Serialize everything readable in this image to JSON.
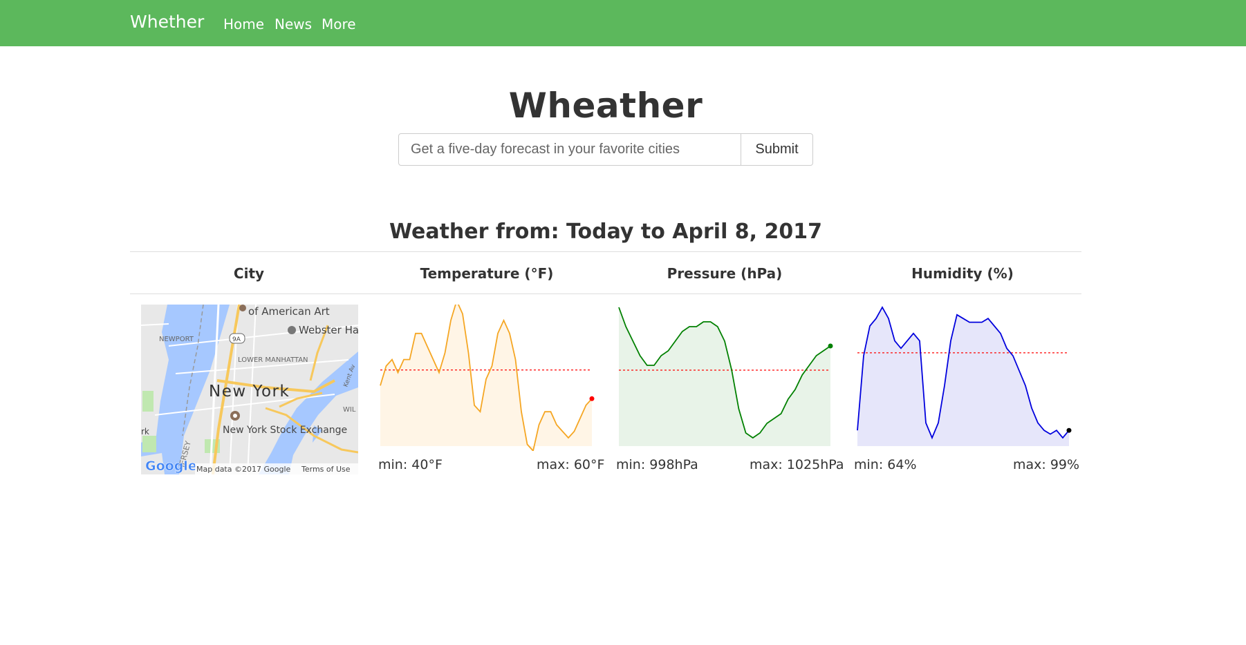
{
  "navbar": {
    "brand": "Whether",
    "links": [
      "Home",
      "News",
      "More"
    ],
    "background": "#5cb85c"
  },
  "main": {
    "title": "Wheather",
    "search_placeholder": "Get a five-day forecast in your favorite cities",
    "submit_label": "Submit",
    "weather_heading": "Weather from: Today to April 8, 2017"
  },
  "table": {
    "headers": [
      "City",
      "Temperature (°F)",
      "Pressure (hPa)",
      "Humidity (%)"
    ]
  },
  "map": {
    "city_label": "New York",
    "labels": [
      "of American Art",
      "Webster Ha",
      "NEWPORT",
      "LOWER MANHATTAN",
      "New York Stock Exchange",
      "9A",
      "WIL",
      "Kent Av",
      "rk",
      "JERSEY"
    ],
    "attribution": "Map data ©2017 Google",
    "terms": "Terms of Use",
    "logo": "Google"
  },
  "chart_data": [
    {
      "type": "area",
      "name": "temperature",
      "color": "#f5a623",
      "fill": "#fff5e6",
      "end_dot": "#ff0000",
      "ylim": [
        40,
        60
      ],
      "mean": 50.4,
      "values": [
        48,
        51,
        52,
        50,
        52,
        52,
        56,
        56,
        54,
        52,
        50,
        53,
        58,
        61,
        59,
        53,
        45,
        44,
        49,
        51,
        56,
        58,
        56,
        52,
        44,
        39,
        38,
        42,
        44,
        44,
        42,
        41,
        40,
        41,
        43,
        45,
        46
      ],
      "min_label": "min: 40°F",
      "max_label": "max: 60°F"
    },
    {
      "type": "area",
      "name": "pressure",
      "color": "#008000",
      "fill": "#e8f3e8",
      "end_dot": "#008000",
      "ylim": [
        998,
        1025
      ],
      "mean": 1012,
      "values": [
        1025,
        1021,
        1018,
        1015,
        1013,
        1013,
        1015,
        1016,
        1018,
        1020,
        1021,
        1021,
        1022,
        1022,
        1021,
        1018,
        1012,
        1004,
        999,
        998,
        999,
        1001,
        1002,
        1003,
        1006,
        1008,
        1011,
        1013,
        1015,
        1016,
        1017
      ],
      "min_label": "min: 998hPa",
      "max_label": "max: 1025hPa"
    },
    {
      "type": "area",
      "name": "humidity",
      "color": "#0000dd",
      "fill": "#e6e6fa",
      "end_dot": "#000000",
      "ylim": [
        64,
        99
      ],
      "mean": 86.8,
      "values": [
        66,
        86,
        94,
        96,
        99,
        96,
        90,
        88,
        90,
        92,
        90,
        68,
        64,
        68,
        78,
        90,
        97,
        96,
        95,
        95,
        95,
        96,
        94,
        92,
        88,
        86,
        82,
        78,
        72,
        68,
        66,
        65,
        66,
        64,
        66
      ]
    }
  ],
  "humidity_labels": {
    "min_label": "min: 64%",
    "max_label": "max: 99%"
  }
}
